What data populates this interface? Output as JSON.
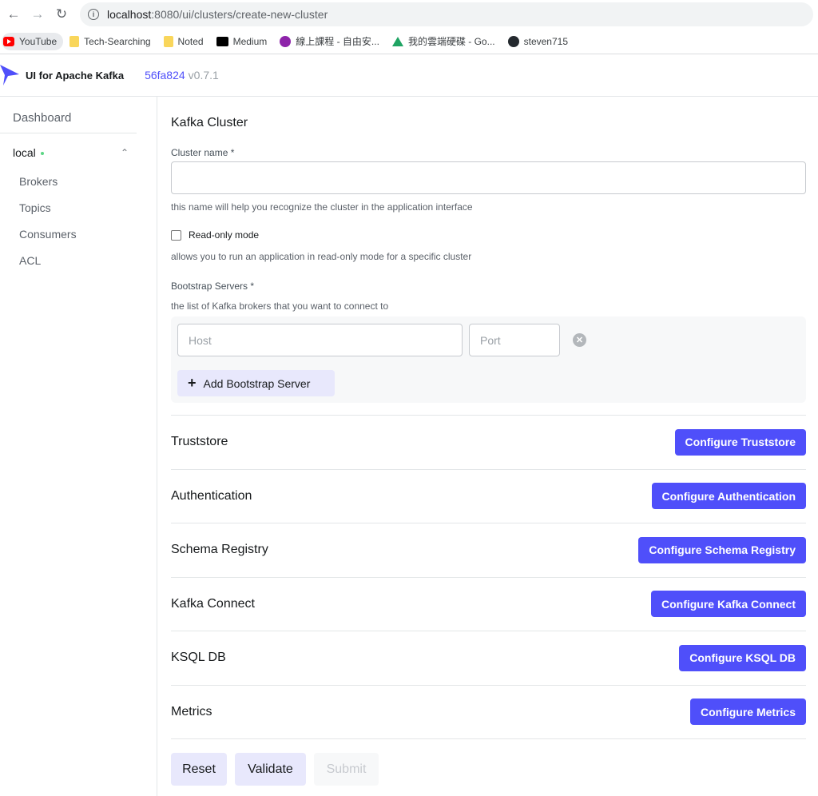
{
  "browser": {
    "url_host": "localhost",
    "url_path": ":8080/ui/clusters/create-new-cluster",
    "bookmarks": [
      {
        "label": "YouTube",
        "icon": "youtube-icon"
      },
      {
        "label": "Tech-Searching",
        "icon": "folder-icon"
      },
      {
        "label": "Noted",
        "icon": "folder-icon"
      },
      {
        "label": "Medium",
        "icon": "medium-icon"
      },
      {
        "label": "線上課程 - 自由安...",
        "icon": "course-icon"
      },
      {
        "label": "我的雲端硬碟 - Go...",
        "icon": "drive-icon"
      },
      {
        "label": "steven715",
        "icon": "github-icon"
      }
    ]
  },
  "header": {
    "app_name": "UI for Apache Kafka",
    "version_hash": "56fa824",
    "version": "v0.7.1"
  },
  "sidebar": {
    "dashboard": "Dashboard",
    "cluster": "local",
    "items": [
      "Brokers",
      "Topics",
      "Consumers",
      "ACL"
    ]
  },
  "form": {
    "title": "Kafka Cluster",
    "cluster_name_label": "Cluster name *",
    "cluster_name_value": "",
    "cluster_name_hint": "this name will help you recognize the cluster in the application interface",
    "readonly_label": "Read-only mode",
    "readonly_checked": false,
    "readonly_hint": "allows you to run an application in read-only mode for a specific cluster",
    "bootstrap_label": "Bootstrap Servers *",
    "bootstrap_hint": "the list of Kafka brokers that you want to connect to",
    "host_placeholder": "Host",
    "port_placeholder": "Port",
    "add_bootstrap": "Add Bootstrap Server"
  },
  "config_sections": [
    {
      "title": "Truststore",
      "button": "Configure Truststore"
    },
    {
      "title": "Authentication",
      "button": "Configure Authentication"
    },
    {
      "title": "Schema Registry",
      "button": "Configure Schema Registry"
    },
    {
      "title": "Kafka Connect",
      "button": "Configure Kafka Connect"
    },
    {
      "title": "KSQL DB",
      "button": "Configure KSQL DB"
    },
    {
      "title": "Metrics",
      "button": "Configure Metrics"
    }
  ],
  "actions": {
    "reset": "Reset",
    "validate": "Validate",
    "submit": "Submit"
  },
  "colors": {
    "accent": "#4f4ffa",
    "secondary_button": "#e8e8fc",
    "cluster_status": "#5cd685"
  }
}
